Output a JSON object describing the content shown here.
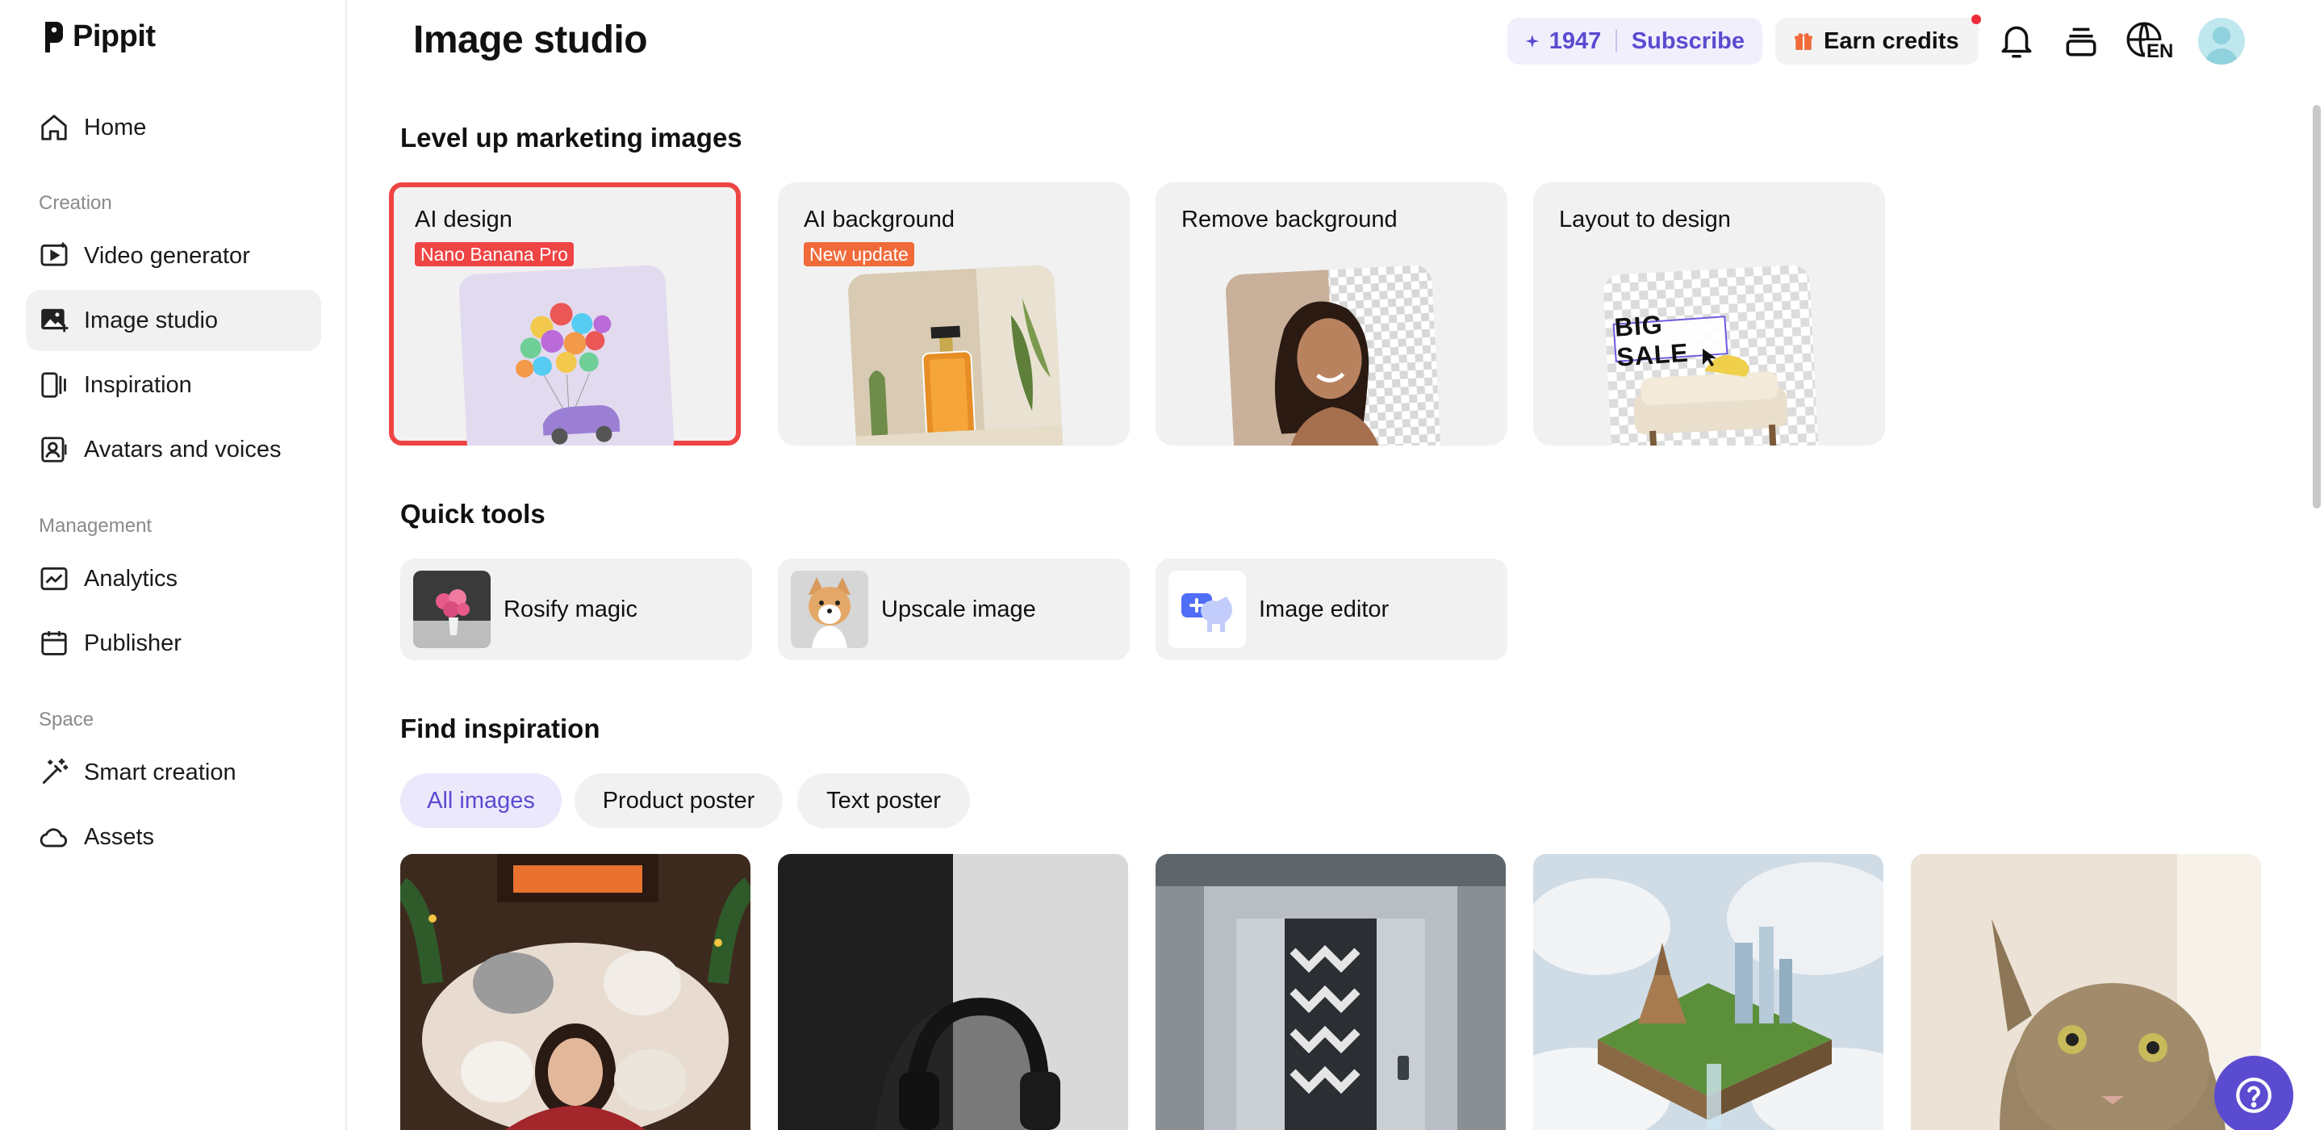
{
  "brand": {
    "name": "Pippit"
  },
  "sidebar": {
    "home": "Home",
    "sections": {
      "creation": "Creation",
      "management": "Management",
      "space": "Space"
    },
    "items": {
      "video_generator": "Video generator",
      "image_studio": "Image studio",
      "inspiration": "Inspiration",
      "avatars_voices": "Avatars and voices",
      "analytics": "Analytics",
      "publisher": "Publisher",
      "smart_creation": "Smart creation",
      "assets": "Assets"
    },
    "active_item": "Image studio"
  },
  "header": {
    "title": "Image studio",
    "credits": "1947",
    "subscribe": "Subscribe",
    "earn_credits": "Earn credits",
    "language": "EN"
  },
  "sections": {
    "marketing": "Level up marketing images",
    "quick_tools": "Quick tools",
    "inspiration": "Find inspiration"
  },
  "feature_cards": [
    {
      "title": "AI design",
      "badge": "Nano Banana Pro",
      "selected": true
    },
    {
      "title": "AI background",
      "badge": "New update"
    },
    {
      "title": "Remove background"
    },
    {
      "title": "Layout to design",
      "thumb_text": "BIG SALE"
    }
  ],
  "quick_tools": [
    {
      "label": "Rosify magic"
    },
    {
      "label": "Upscale image"
    },
    {
      "label": "Image editor"
    }
  ],
  "filters": [
    {
      "label": "All images",
      "active": true
    },
    {
      "label": "Product poster"
    },
    {
      "label": "Text poster"
    }
  ],
  "colors": {
    "accent": "#5b4bd1",
    "selection": "#ef4444",
    "badge_red": "#ef4444",
    "badge_orange": "#f06a3a"
  }
}
